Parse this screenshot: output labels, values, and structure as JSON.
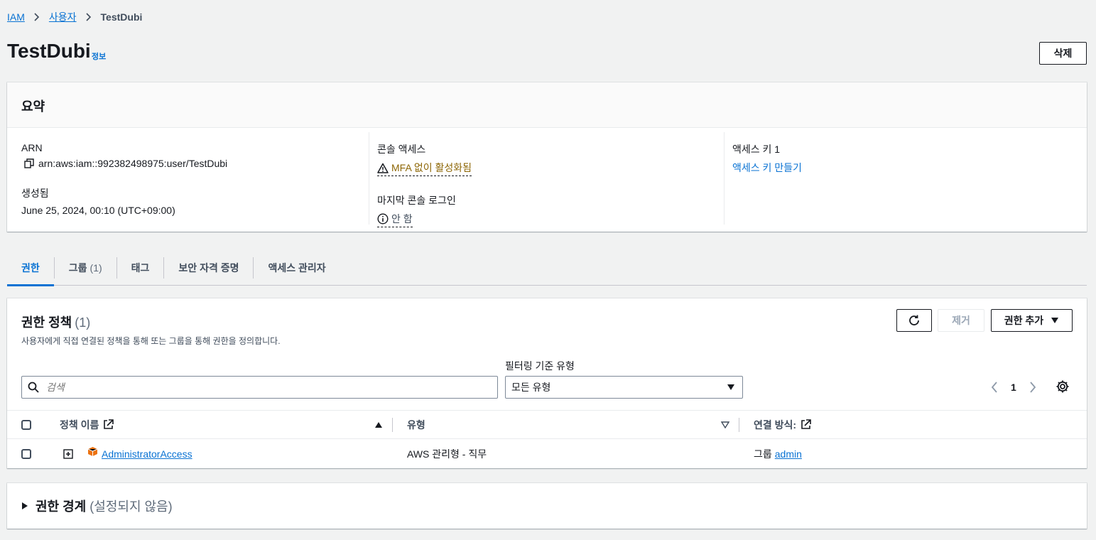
{
  "breadcrumb": {
    "root": "IAM",
    "users": "사용자",
    "current": "TestDubi"
  },
  "header": {
    "title": "TestDubi",
    "info": "정보",
    "delete_label": "삭제"
  },
  "summary": {
    "title": "요약",
    "arn_label": "ARN",
    "arn_value": "arn:aws:iam::992382498975:user/TestDubi",
    "created_label": "생성됨",
    "created_value": "June 25, 2024, 00:10 (UTC+09:00)",
    "console_access_label": "콘솔 액세스",
    "console_access_value": "MFA 없이 활성화됨",
    "last_login_label": "마지막 콘솔 로그인",
    "last_login_value": "안 함",
    "access_key_label": "액세스 키 1",
    "access_key_value": "액세스 키 만들기"
  },
  "tabs": [
    {
      "label": "권한",
      "count": ""
    },
    {
      "label": "그룹",
      "count": "(1)"
    },
    {
      "label": "태그",
      "count": ""
    },
    {
      "label": "보안 자격 증명",
      "count": ""
    },
    {
      "label": "액세스 관리자",
      "count": ""
    }
  ],
  "policies": {
    "title": "권한 정책",
    "count": "(1)",
    "description": "사용자에게 직접 연결된 정책을 통해 또는 그룹을 통해 권한을 정의합니다.",
    "remove_label": "제거",
    "add_label": "권한 추가",
    "filter_label": "필터링 기준 유형",
    "search_placeholder": "검색",
    "filter_value": "모든 유형",
    "page": "1",
    "columns": {
      "name": "정책 이름",
      "type": "유형",
      "attached": "연결 방식:"
    },
    "rows": [
      {
        "name": "AdministratorAccess",
        "type": "AWS 관리형 - 직무",
        "attached_prefix": "그룹",
        "attached_link": "admin"
      }
    ]
  },
  "boundary": {
    "title": "권한 경계",
    "subtitle": "(설정되지 않음)"
  },
  "colors": {
    "link": "#0972d3",
    "warning": "#8d6605",
    "aws_orange": "#ec7211"
  }
}
